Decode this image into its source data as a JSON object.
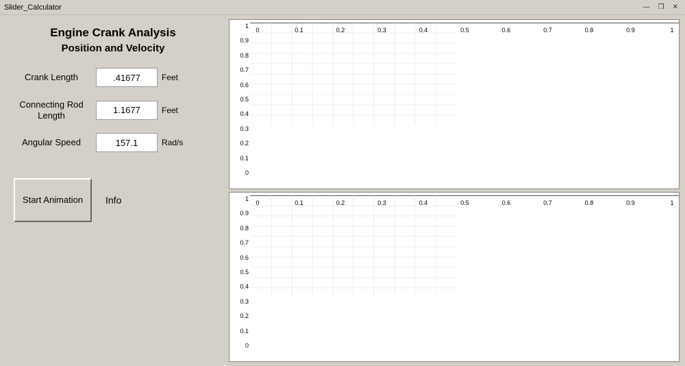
{
  "titlebar": {
    "title": "Slider_Calculator",
    "minimize_label": "—",
    "restore_label": "❐",
    "close_label": "✕"
  },
  "left_panel": {
    "app_title": "Engine Crank Analysis",
    "app_subtitle": "Position and Velocity",
    "fields": [
      {
        "label": "Crank Length",
        "value": ".41677",
        "unit": "Feet"
      },
      {
        "label": "Connecting Rod Length",
        "value": "1.1677",
        "unit": "Feet"
      },
      {
        "label": "Angular Speed",
        "value": "157.1",
        "unit": "Rad/s"
      }
    ],
    "start_button_label": "Start Animation",
    "info_label": "Info"
  },
  "charts": {
    "top_chart": {
      "y_axis": [
        "1",
        "0.9",
        "0.8",
        "0.7",
        "0.6",
        "0.5",
        "0.4",
        "0.3",
        "0.2",
        "0.1",
        "0"
      ],
      "x_axis": [
        "0",
        "0.1",
        "0.2",
        "0.3",
        "0.4",
        "0.5",
        "0.6",
        "0.7",
        "0.8",
        "0.9",
        "1"
      ]
    },
    "bottom_chart": {
      "y_axis": [
        "1",
        "0.9",
        "0.8",
        "0.7",
        "0.6",
        "0.5",
        "0.4",
        "0.3",
        "0.2",
        "0.1",
        "0"
      ],
      "x_axis": [
        "0",
        "0.1",
        "0.2",
        "0.3",
        "0.4",
        "0.5",
        "0.6",
        "0.7",
        "0.8",
        "0.9",
        "1"
      ]
    }
  }
}
